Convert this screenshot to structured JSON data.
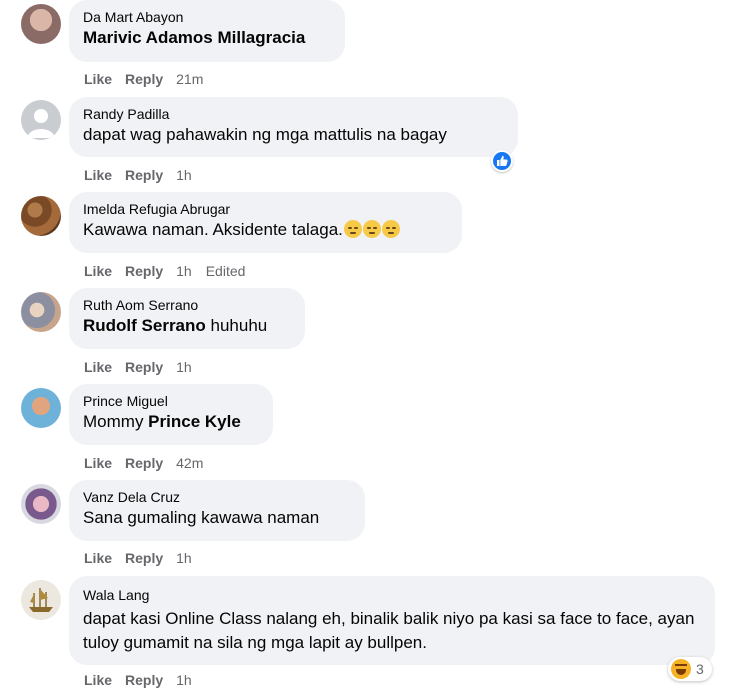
{
  "actions": {
    "like": "Like",
    "reply": "Reply"
  },
  "comments": [
    {
      "author": "Da Mart Abayon",
      "parts": [
        {
          "text": "Marivic Adamos Millagracia",
          "mention": true
        }
      ],
      "time": "21m",
      "edited": ""
    },
    {
      "author": "Randy Padilla",
      "parts": [
        {
          "text": "dapat wag pahawakin ng mga mattulis na bagay",
          "mention": false
        }
      ],
      "time": "1h",
      "edited": ""
    },
    {
      "author": "Imelda Refugia Abrugar",
      "parts": [
        {
          "text": "Kawawa naman. Aksidente talaga.",
          "mention": false
        }
      ],
      "emojis": [
        "pensive-face-icon",
        "pensive-face-icon",
        "pensive-face-icon"
      ],
      "time": "1h",
      "edited": "Edited"
    },
    {
      "author": "Ruth Aom Serrano",
      "parts": [
        {
          "text": "Rudolf Serrano",
          "mention": true
        },
        {
          "text": " huhuhu",
          "mention": false
        }
      ],
      "time": "1h",
      "edited": ""
    },
    {
      "author": "Prince Miguel",
      "parts": [
        {
          "text": "Mommy ",
          "mention": false
        },
        {
          "text": "Prince Kyle",
          "mention": true
        }
      ],
      "time": "42m",
      "edited": ""
    },
    {
      "author": "Vanz Dela Cruz",
      "parts": [
        {
          "text": "Sana gumaling kawawa naman",
          "mention": false
        }
      ],
      "time": "1h",
      "edited": ""
    },
    {
      "author": "Wala Lang",
      "parts": [
        {
          "text": "dapat kasi Online Class nalang eh, binalik balik niyo pa kasi sa face to face, ayan tuloy gumamit na sila ng mga lapit ay bullpen.",
          "mention": false
        }
      ],
      "time": "1h",
      "edited": ""
    }
  ],
  "reactions": {
    "like_badge_icon": "thumbs-up-icon",
    "haha_icon": "haha-icon",
    "haha_count": "3"
  },
  "colors": {
    "bubble": "#f0f2f5",
    "meta_text": "#65676b",
    "like_blue": "#1877f2"
  }
}
